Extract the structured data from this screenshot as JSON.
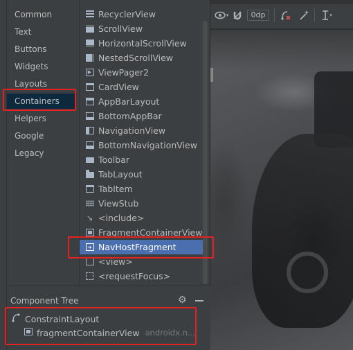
{
  "categories": [
    "Common",
    "Text",
    "Buttons",
    "Widgets",
    "Layouts",
    "Containers",
    "Helpers",
    "Google",
    "Legacy"
  ],
  "selected_category": "Containers",
  "palette_items": [
    {
      "label": "RecyclerView",
      "icon": "list-icon"
    },
    {
      "label": "ScrollView",
      "icon": "scrollview-icon"
    },
    {
      "label": "HorizontalScrollView",
      "icon": "horizontal-scroll-icon"
    },
    {
      "label": "NestedScrollView",
      "icon": "nested-scroll-icon"
    },
    {
      "label": "ViewPager2",
      "icon": "viewpager-icon"
    },
    {
      "label": "CardView",
      "icon": "card-icon"
    },
    {
      "label": "AppBarLayout",
      "icon": "appbar-icon"
    },
    {
      "label": "BottomAppBar",
      "icon": "bottom-appbar-icon"
    },
    {
      "label": "NavigationView",
      "icon": "navigation-view-icon"
    },
    {
      "label": "BottomNavigationView",
      "icon": "bottom-navigation-icon"
    },
    {
      "label": "Toolbar",
      "icon": "toolbar-icon"
    },
    {
      "label": "TabLayout",
      "icon": "tab-layout-icon"
    },
    {
      "label": "TabItem",
      "icon": "tab-item-icon"
    },
    {
      "label": "ViewStub",
      "icon": "viewstub-icon"
    },
    {
      "label": "<include>",
      "icon": "include-icon"
    },
    {
      "label": "FragmentContainerView",
      "icon": "fragment-container-icon"
    },
    {
      "label": "NavHostFragment",
      "icon": "nav-host-fragment-icon"
    },
    {
      "label": "<view>",
      "icon": "view-icon"
    },
    {
      "label": "<requestFocus>",
      "icon": "request-focus-icon"
    }
  ],
  "selected_palette_item": "NavHostFragment",
  "toolbar": {
    "default_margin": "0dp"
  },
  "component_tree": {
    "title": "Component Tree",
    "root": {
      "label": "ConstraintLayout"
    },
    "child": {
      "label": "fragmentContainerView",
      "sub": "androidx.n..."
    }
  },
  "colors": {
    "selection": "#4b6eaf",
    "highlight": "#e52222",
    "panel": "#3c3f41"
  }
}
